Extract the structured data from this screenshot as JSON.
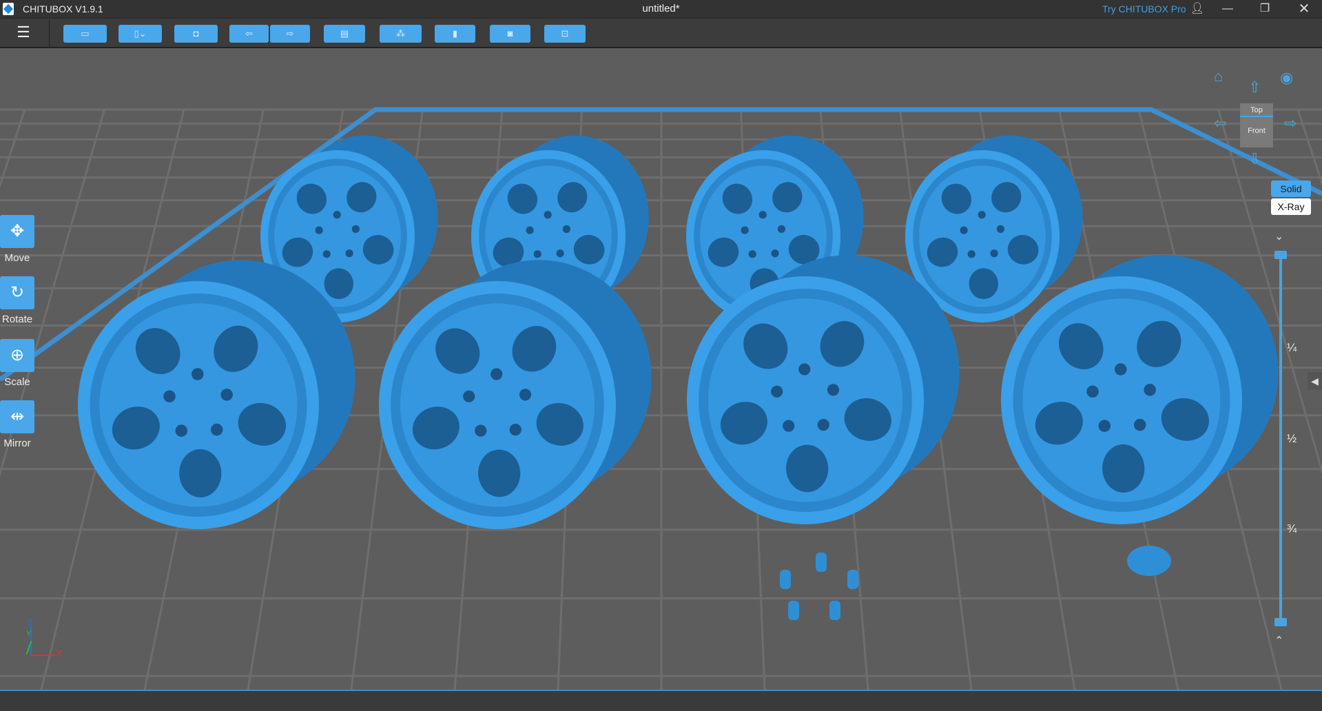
{
  "titlebar": {
    "app": "CHITUBOX V1.9.1",
    "document": "untitled*",
    "try_pro": "Try CHITUBOX Pro"
  },
  "toolbar": {
    "menu_icon": "☰",
    "buttons": [
      {
        "name": "open-file",
        "icon": "▭"
      },
      {
        "name": "save",
        "icon": "▯⌄"
      },
      {
        "name": "screenshot",
        "icon": "◘"
      },
      {
        "name": "undo",
        "icon": "⇦"
      },
      {
        "name": "redo",
        "icon": "⇨"
      },
      {
        "name": "list",
        "icon": "▤"
      },
      {
        "name": "supports",
        "icon": "⁂"
      },
      {
        "name": "hollow",
        "icon": "▮"
      },
      {
        "name": "slice-preview",
        "icon": "◙"
      },
      {
        "name": "settings",
        "icon": "⊡"
      }
    ]
  },
  "left_tools": [
    {
      "label": "Move",
      "icon": "✥"
    },
    {
      "label": "Rotate",
      "icon": "↻"
    },
    {
      "label": "Scale",
      "icon": "⊕"
    },
    {
      "label": "Mirror",
      "icon": "⇹"
    }
  ],
  "view": {
    "cube_top": "Top",
    "cube_front": "Front",
    "solid": "Solid",
    "xray": "X-Ray"
  },
  "slider": {
    "fractions": [
      "¼",
      "½",
      "¾"
    ],
    "top_value": 0,
    "bottom_value": 1
  },
  "axes": {
    "x": "X",
    "y": "Y",
    "z": "Z"
  },
  "colors": {
    "accent": "#49a7ea",
    "model": "#2f8fd6",
    "floor": "#5d5d5d"
  }
}
